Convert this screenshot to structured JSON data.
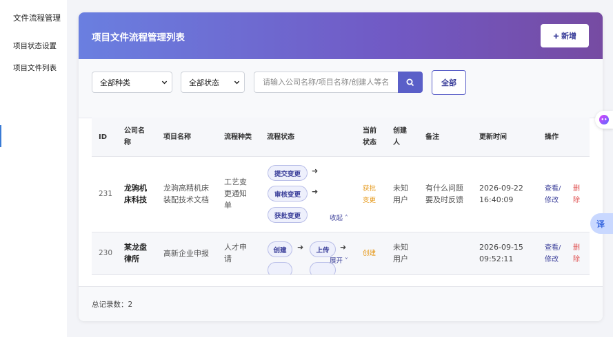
{
  "sidebar": {
    "title": "文件流程管理",
    "items": [
      {
        "label": "项目状态设置"
      },
      {
        "label": "项目文件列表"
      }
    ]
  },
  "header": {
    "title": "项目文件流程管理列表",
    "new_button": "新增"
  },
  "filters": {
    "category": "全部种类",
    "status": "全部状态",
    "search_placeholder": "请输入公司名称/项目名称/创建人等名",
    "all_button": "全部"
  },
  "table": {
    "columns": {
      "id": "ID",
      "company": "公司名称",
      "project": "项目名称",
      "flow_type": "流程种类",
      "flow_status": "流程状态",
      "current_status": "当前状态",
      "creator": "创建人",
      "remark": "备注",
      "updated": "更新时间",
      "actions": "操作"
    },
    "rows": [
      {
        "id": "231",
        "company": "龙驹机床科技",
        "project": "龙驹高精机床装配技术文档",
        "flow_type": "工艺变更通知单",
        "flow_steps": [
          "提交变更",
          "审核变更",
          "获批变更"
        ],
        "toggle": "收起",
        "current_status": "获批变更",
        "creator": "未知用户",
        "remark": "有什么问题要及时反馈",
        "updated": "2026-09-22 16:40:09",
        "view": "查看/修改",
        "delete": "删除"
      },
      {
        "id": "230",
        "company": "某龙盘律所",
        "project": "高新企业申报",
        "flow_type": "人才申请",
        "flow_steps": [
          "创建",
          "上传"
        ],
        "toggle": "展开",
        "current_status": "创建",
        "creator": "未知用户",
        "remark": "",
        "updated": "2026-09-15 09:52:11",
        "view": "查看/修改",
        "delete": "删除"
      }
    ]
  },
  "footer": {
    "total": "总记录数：2"
  },
  "floating": {
    "translate": "译"
  },
  "colors": {
    "header_gradient_start": "#6a7fe0",
    "header_gradient_end": "#764ba2",
    "accent": "#5a5fc8",
    "status_orange": "#e69a1d",
    "delete_red": "#e05555"
  }
}
